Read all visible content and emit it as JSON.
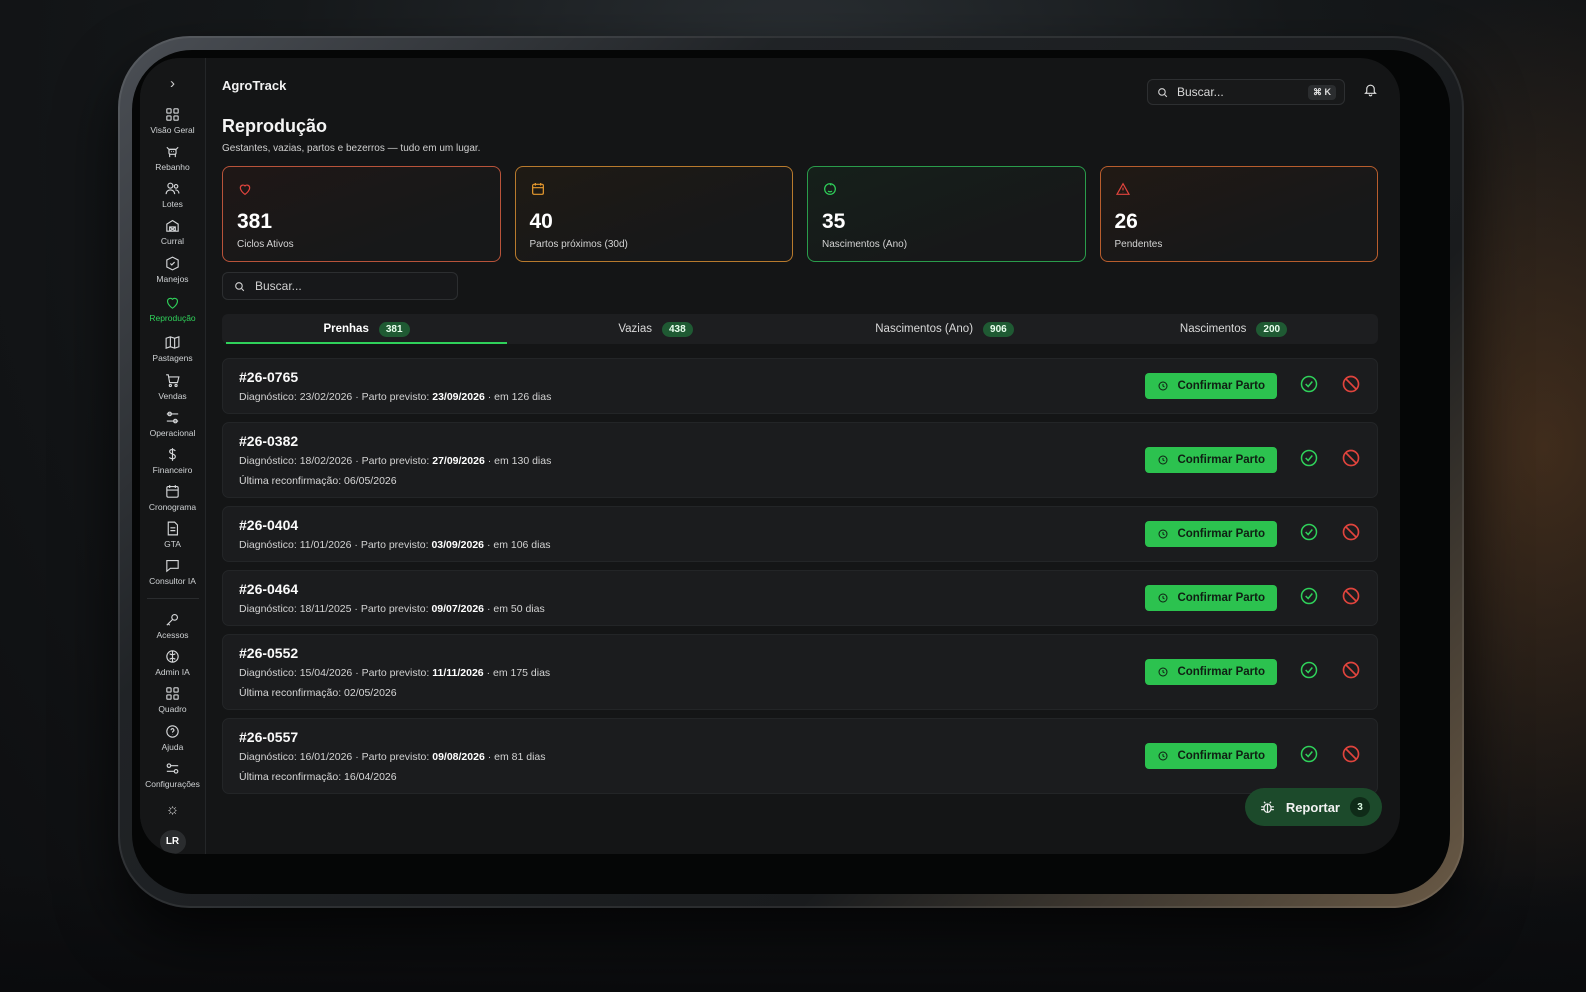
{
  "app": {
    "title": "AgroTrack"
  },
  "sidebar": {
    "items": [
      {
        "label": "Visão Geral",
        "icon": "grid-icon"
      },
      {
        "label": "Rebanho",
        "icon": "cattle-icon"
      },
      {
        "label": "Lotes",
        "icon": "users-icon"
      },
      {
        "label": "Curral",
        "icon": "barn-icon"
      },
      {
        "label": "Manejos",
        "icon": "clipboard-icon"
      },
      {
        "label": "Reprodução",
        "icon": "heart-icon",
        "active": true
      },
      {
        "label": "Pastagens",
        "icon": "map-icon"
      },
      {
        "label": "Vendas",
        "icon": "cart-icon"
      },
      {
        "label": "Operacional",
        "icon": "sliders-icon"
      },
      {
        "label": "Financeiro",
        "icon": "dollar-icon"
      },
      {
        "label": "Cronograma",
        "icon": "calendar-icon"
      },
      {
        "label": "GTA",
        "icon": "document-icon"
      },
      {
        "label": "Consultor IA",
        "icon": "chat-icon"
      }
    ],
    "admin_items": [
      {
        "label": "Acessos",
        "icon": "key-icon"
      },
      {
        "label": "Admin IA",
        "icon": "brain-icon"
      },
      {
        "label": "Quadro",
        "icon": "board-icon"
      },
      {
        "label": "Ajuda",
        "icon": "help-icon"
      },
      {
        "label": "Configurações",
        "icon": "settings-icon"
      }
    ],
    "avatar_initials": "LR"
  },
  "topbar": {
    "search_placeholder": "Buscar...",
    "shortcut": "⌘ K"
  },
  "page": {
    "title": "Reprodução",
    "subtitle": "Gestantes, vazias, partos e bezerros — tudo em um lugar."
  },
  "stats": [
    {
      "value": "381",
      "label": "Ciclos Ativos",
      "icon": "heart-icon",
      "color": "#e0443d"
    },
    {
      "value": "40",
      "label": "Partos próximos (30d)",
      "icon": "calendar-icon",
      "color": "#e89a2e"
    },
    {
      "value": "35",
      "label": "Nascimentos (Ano)",
      "icon": "baby-icon",
      "color": "#2fd15a"
    },
    {
      "value": "26",
      "label": "Pendentes",
      "icon": "warning-icon",
      "color": "#e0443d"
    }
  ],
  "list_search": {
    "placeholder": "Buscar..."
  },
  "tabs": [
    {
      "label": "Prenhas",
      "count": "381",
      "active": true
    },
    {
      "label": "Vazias",
      "count": "438"
    },
    {
      "label": "Nascimentos (Ano)",
      "count": "906"
    },
    {
      "label": "Nascimentos",
      "count": "200"
    }
  ],
  "records": [
    {
      "id": "#26-0765",
      "diag_label": "Diagnóstico:",
      "diag": "23/02/2026",
      "sep": "·",
      "parto_label": "Parto previsto:",
      "parto": "23/09/2026",
      "in_days": "em 126 dias",
      "reconf": ""
    },
    {
      "id": "#26-0382",
      "diag_label": "Diagnóstico:",
      "diag": "18/02/2026",
      "sep": "·",
      "parto_label": "Parto previsto:",
      "parto": "27/09/2026",
      "in_days": "em 130 dias",
      "reconf": "Última reconfirmação: 06/05/2026"
    },
    {
      "id": "#26-0404",
      "diag_label": "Diagnóstico:",
      "diag": "11/01/2026",
      "sep": "·",
      "parto_label": "Parto previsto:",
      "parto": "03/09/2026",
      "in_days": "em 106 dias",
      "reconf": ""
    },
    {
      "id": "#26-0464",
      "diag_label": "Diagnóstico:",
      "diag": "18/11/2025",
      "sep": "·",
      "parto_label": "Parto previsto:",
      "parto": "09/07/2026",
      "in_days": "em 50 dias",
      "reconf": ""
    },
    {
      "id": "#26-0552",
      "diag_label": "Diagnóstico:",
      "diag": "15/04/2026",
      "sep": "·",
      "parto_label": "Parto previsto:",
      "parto": "11/11/2026",
      "in_days": "em 175 dias",
      "reconf": "Última reconfirmação: 02/05/2026"
    },
    {
      "id": "#26-0557",
      "diag_label": "Diagnóstico:",
      "diag": "16/01/2026",
      "sep": "·",
      "parto_label": "Parto previsto:",
      "parto": "09/08/2026",
      "in_days": "em 81 dias",
      "reconf": "Última reconfirmação: 16/04/2026"
    }
  ],
  "record_actions": {
    "confirm_label": "Confirmar Parto"
  },
  "report": {
    "label": "Reportar",
    "count": "3"
  },
  "colors": {
    "accent": "#2cc24f",
    "danger": "#e0443d",
    "badge": "#1f5a33"
  }
}
